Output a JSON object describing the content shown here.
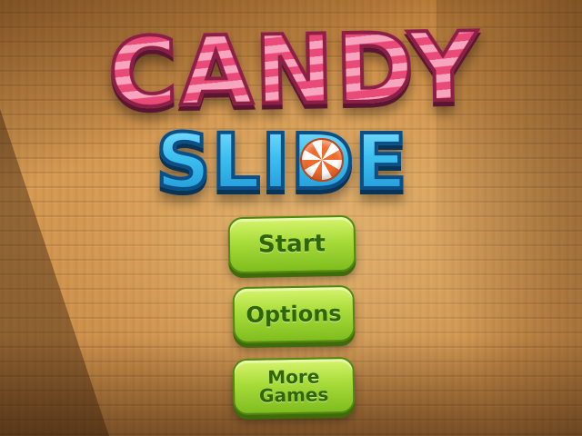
{
  "game": {
    "title_line1": "CANDY",
    "title_line2": "SLIDE",
    "logo_colors": {
      "candy_pink": "#f25a86",
      "slide_blue": "#3cc0ef"
    }
  },
  "menu": {
    "buttons": [
      {
        "id": "start",
        "label": "Start",
        "icon": ""
      },
      {
        "id": "options",
        "label": "Options",
        "icon": ""
      },
      {
        "id": "more_games",
        "label": "More Games",
        "icon": ""
      }
    ],
    "button_color": "#a8dc3a",
    "label_color": "#2f6607"
  },
  "background": {
    "style": "wood-planks",
    "base_color": "#c8873f"
  },
  "decorations": {
    "candy_icon": "peppermint-candy-icon"
  }
}
